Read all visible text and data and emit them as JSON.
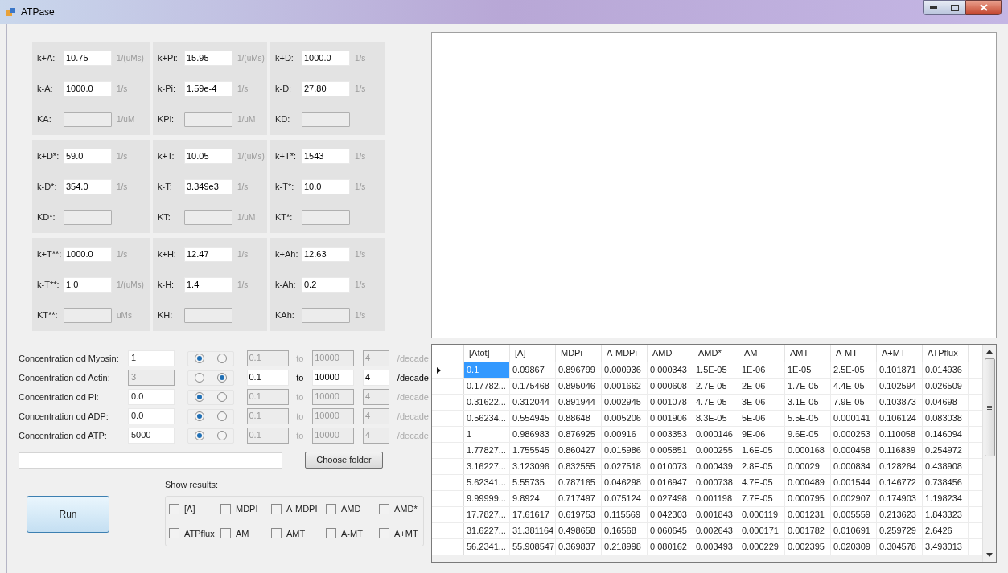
{
  "window": {
    "title": "ATPase"
  },
  "parameter_groups": [
    {
      "rows": [
        {
          "label": "k+A:",
          "value": "10.75",
          "unit": "1/(uMs)",
          "disabled": false
        },
        {
          "label": "k-A:",
          "value": "1000.0",
          "unit": "1/s",
          "disabled": false
        },
        {
          "label": "KA:",
          "unit": "1/uM",
          "disabled": true
        }
      ]
    },
    {
      "rows": [
        {
          "label": "k+Pi:",
          "value": "15.95",
          "unit": "1/(uMs)",
          "disabled": false
        },
        {
          "label": "k-Pi:",
          "value": "1.59e-4",
          "unit": "1/s",
          "disabled": false
        },
        {
          "label": "KPi:",
          "unit": "1/uM",
          "disabled": true
        }
      ]
    },
    {
      "rows": [
        {
          "label": "k+D:",
          "value": "1000.0",
          "unit": "1/s",
          "disabled": false
        },
        {
          "label": "k-D:",
          "value": "27.80",
          "unit": "1/s",
          "disabled": false
        },
        {
          "label": "KD:",
          "disabled": true
        }
      ]
    },
    {
      "rows": [
        {
          "label": "k+D*:",
          "value": "59.0",
          "unit": "1/s",
          "disabled": false
        },
        {
          "label": "k-D*:",
          "value": "354.0",
          "unit": "1/s",
          "disabled": false
        },
        {
          "label": "KD*:",
          "disabled": true
        }
      ]
    },
    {
      "rows": [
        {
          "label": "k+T:",
          "value": "10.05",
          "unit": "1/(uMs)",
          "disabled": false
        },
        {
          "label": "k-T:",
          "value": "3.349e3",
          "unit": "1/s",
          "disabled": false
        },
        {
          "label": "KT:",
          "unit": "1/uM",
          "disabled": true
        }
      ]
    },
    {
      "rows": [
        {
          "label": "k+T*:",
          "value": "1543",
          "unit": "1/s",
          "disabled": false
        },
        {
          "label": "k-T*:",
          "value": "10.0",
          "unit": "1/s",
          "disabled": false
        },
        {
          "label": "KT*:",
          "disabled": true
        }
      ]
    },
    {
      "rows": [
        {
          "label": "k+T**:",
          "value": "1000.0",
          "unit": "1/s",
          "disabled": false
        },
        {
          "label": "k-T**:",
          "value": "1.0",
          "unit": "1/(uMs)",
          "disabled": false
        },
        {
          "label": "KT**:",
          "unit": "uMs",
          "disabled": true
        }
      ]
    },
    {
      "rows": [
        {
          "label": "k+H:",
          "value": "12.47",
          "unit": "1/s",
          "disabled": false
        },
        {
          "label": "k-H:",
          "value": "1.4",
          "unit": "1/s",
          "disabled": false
        },
        {
          "label": "KH:",
          "disabled": true
        }
      ]
    },
    {
      "rows": [
        {
          "label": "k+Ah:",
          "value": "12.63",
          "unit": "1/s",
          "disabled": false
        },
        {
          "label": "k-Ah:",
          "value": "0.2",
          "unit": "1/s",
          "disabled": false
        },
        {
          "label": "KAh:",
          "unit": "1/s",
          "disabled": true
        }
      ]
    }
  ],
  "concentrations": [
    {
      "label": "Concentration od Myosin:",
      "value": "1",
      "radios": [
        {
          "selected": true
        },
        {
          "selected": false
        }
      ],
      "from": "0.1",
      "to_label": "to",
      "to": "10000",
      "per": "4",
      "per_unit": "/decade"
    },
    {
      "label": "Concentration od Actin:",
      "value": "3",
      "radios": [
        {
          "selected": false
        },
        {
          "selected": true
        }
      ],
      "from": "0.1",
      "to_label": "to",
      "to": "10000",
      "per": "4",
      "per_unit": "/decade"
    },
    {
      "label": "Concentration od Pi:",
      "value": "0.0",
      "radios": [
        {
          "selected": true
        },
        {
          "selected": false
        }
      ],
      "from": "0.1",
      "to_label": "to",
      "to": "10000",
      "per": "4",
      "per_unit": "/decade"
    },
    {
      "label": "Concentration od ADP:",
      "value": "0.0",
      "radios": [
        {
          "selected": true
        },
        {
          "selected": false
        }
      ],
      "from": "0.1",
      "to_label": "to",
      "to": "10000",
      "per": "4",
      "per_unit": "/decade"
    },
    {
      "label": "Concentration od ATP:",
      "value": "5000",
      "radios": [
        {
          "selected": true
        },
        {
          "selected": false
        }
      ],
      "from": "0.1",
      "to_label": "to",
      "to": "10000",
      "per": "4",
      "per_unit": "/decade"
    }
  ],
  "choose_folder_button": "Choose folder",
  "run_button": "Run",
  "show_results": {
    "label": "Show results:",
    "options": [
      {
        "label": "[A]",
        "checked": false
      },
      {
        "label": "MDPI",
        "checked": false
      },
      {
        "label": "A-MDPI",
        "checked": false
      },
      {
        "label": "AMD",
        "checked": false
      },
      {
        "label": "AMD*",
        "checked": false
      },
      {
        "label": "ATPflux",
        "checked": false
      },
      {
        "label": "AM",
        "checked": false
      },
      {
        "label": "AMT",
        "checked": false
      },
      {
        "label": "A-MT",
        "checked": false
      },
      {
        "label": "A+MT",
        "checked": false
      }
    ]
  },
  "table": {
    "columns": [
      "[Atot]",
      "[A]",
      "MDPi",
      "A-MDPi",
      "AMD",
      "AMD*",
      "AM",
      "AMT",
      "A-MT",
      "A+MT",
      "ATPflux"
    ],
    "rows": [
      {
        "selected": true,
        "cells": [
          "0.1",
          "0.09867",
          "0.896799",
          "0.000936",
          "0.000343",
          "1.5E-05",
          "1E-06",
          "1E-05",
          "2.5E-05",
          "0.101871",
          "0.014936"
        ]
      },
      {
        "selected": false,
        "cells": [
          "0.17782...",
          "0.175468",
          "0.895046",
          "0.001662",
          "0.000608",
          "2.7E-05",
          "2E-06",
          "1.7E-05",
          "4.4E-05",
          "0.102594",
          "0.026509"
        ]
      },
      {
        "selected": false,
        "cells": [
          "0.31622...",
          "0.312044",
          "0.891944",
          "0.002945",
          "0.001078",
          "4.7E-05",
          "3E-06",
          "3.1E-05",
          "7.9E-05",
          "0.103873",
          "0.04698"
        ]
      },
      {
        "selected": false,
        "cells": [
          "0.56234...",
          "0.554945",
          "0.88648",
          "0.005206",
          "0.001906",
          "8.3E-05",
          "5E-06",
          "5.5E-05",
          "0.000141",
          "0.106124",
          "0.083038"
        ]
      },
      {
        "selected": false,
        "cells": [
          "1",
          "0.986983",
          "0.876925",
          "0.00916",
          "0.003353",
          "0.000146",
          "9E-06",
          "9.6E-05",
          "0.000253",
          "0.110058",
          "0.146094"
        ]
      },
      {
        "selected": false,
        "cells": [
          "1.77827...",
          "1.755545",
          "0.860427",
          "0.015986",
          "0.005851",
          "0.000255",
          "1.6E-05",
          "0.000168",
          "0.000458",
          "0.116839",
          "0.254972"
        ]
      },
      {
        "selected": false,
        "cells": [
          "3.16227...",
          "3.123096",
          "0.832555",
          "0.027518",
          "0.010073",
          "0.000439",
          "2.8E-05",
          "0.00029",
          "0.000834",
          "0.128264",
          "0.438908"
        ]
      },
      {
        "selected": false,
        "cells": [
          "5.62341...",
          "5.55735",
          "0.787165",
          "0.046298",
          "0.016947",
          "0.000738",
          "4.7E-05",
          "0.000489",
          "0.001544",
          "0.146772",
          "0.738456"
        ]
      },
      {
        "selected": false,
        "cells": [
          "9.99999...",
          "9.8924",
          "0.717497",
          "0.075124",
          "0.027498",
          "0.001198",
          "7.7E-05",
          "0.000795",
          "0.002907",
          "0.174903",
          "1.198234"
        ]
      },
      {
        "selected": false,
        "cells": [
          "17.7827...",
          "17.61617",
          "0.619753",
          "0.115569",
          "0.042303",
          "0.001843",
          "0.000119",
          "0.001231",
          "0.005559",
          "0.213623",
          "1.843323"
        ]
      },
      {
        "selected": false,
        "cells": [
          "31.6227...",
          "31.381164",
          "0.498658",
          "0.16568",
          "0.060645",
          "0.002643",
          "0.000171",
          "0.001782",
          "0.010691",
          "0.259729",
          "2.6426"
        ]
      },
      {
        "selected": false,
        "cells": [
          "56.2341...",
          "55.908547",
          "0.369837",
          "0.218998",
          "0.080162",
          "0.003493",
          "0.000229",
          "0.002395",
          "0.020309",
          "0.304578",
          "3.493013"
        ]
      }
    ]
  }
}
